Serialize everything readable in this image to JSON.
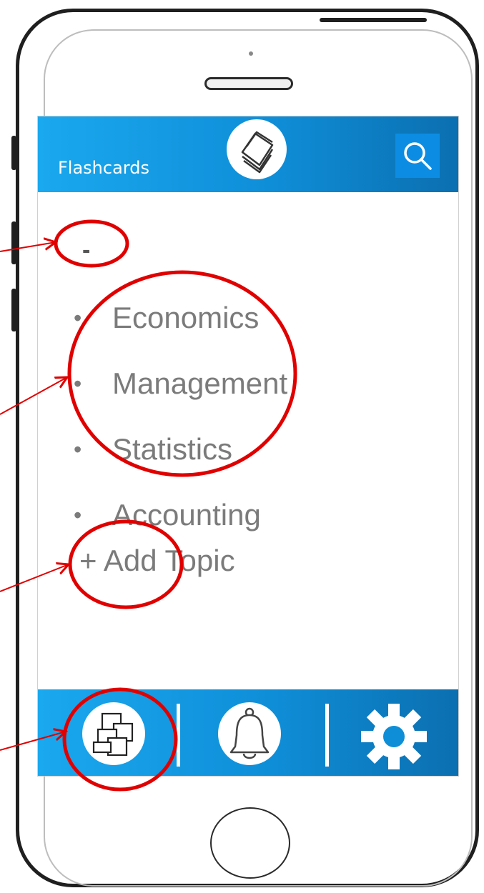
{
  "header": {
    "title": "Flashcards",
    "logo_icon": "stacked-cards-icon",
    "search_icon": "search-icon"
  },
  "topics": {
    "collapse_label": "-",
    "items": [
      {
        "label": "Economics"
      },
      {
        "label": "Management"
      },
      {
        "label": "Statistics"
      },
      {
        "label": "Accounting"
      }
    ],
    "bullet": "•",
    "add_label": "+ Add Topic"
  },
  "footer": {
    "tabs": [
      {
        "icon": "flashcard-stack-icon"
      },
      {
        "icon": "bell-icon"
      },
      {
        "icon": "gear-icon"
      }
    ]
  },
  "colors": {
    "header_start": "#1aa8ee",
    "header_end": "#0b6fb0",
    "annotation": "#e00000",
    "text_gray": "#7b7b7b"
  }
}
